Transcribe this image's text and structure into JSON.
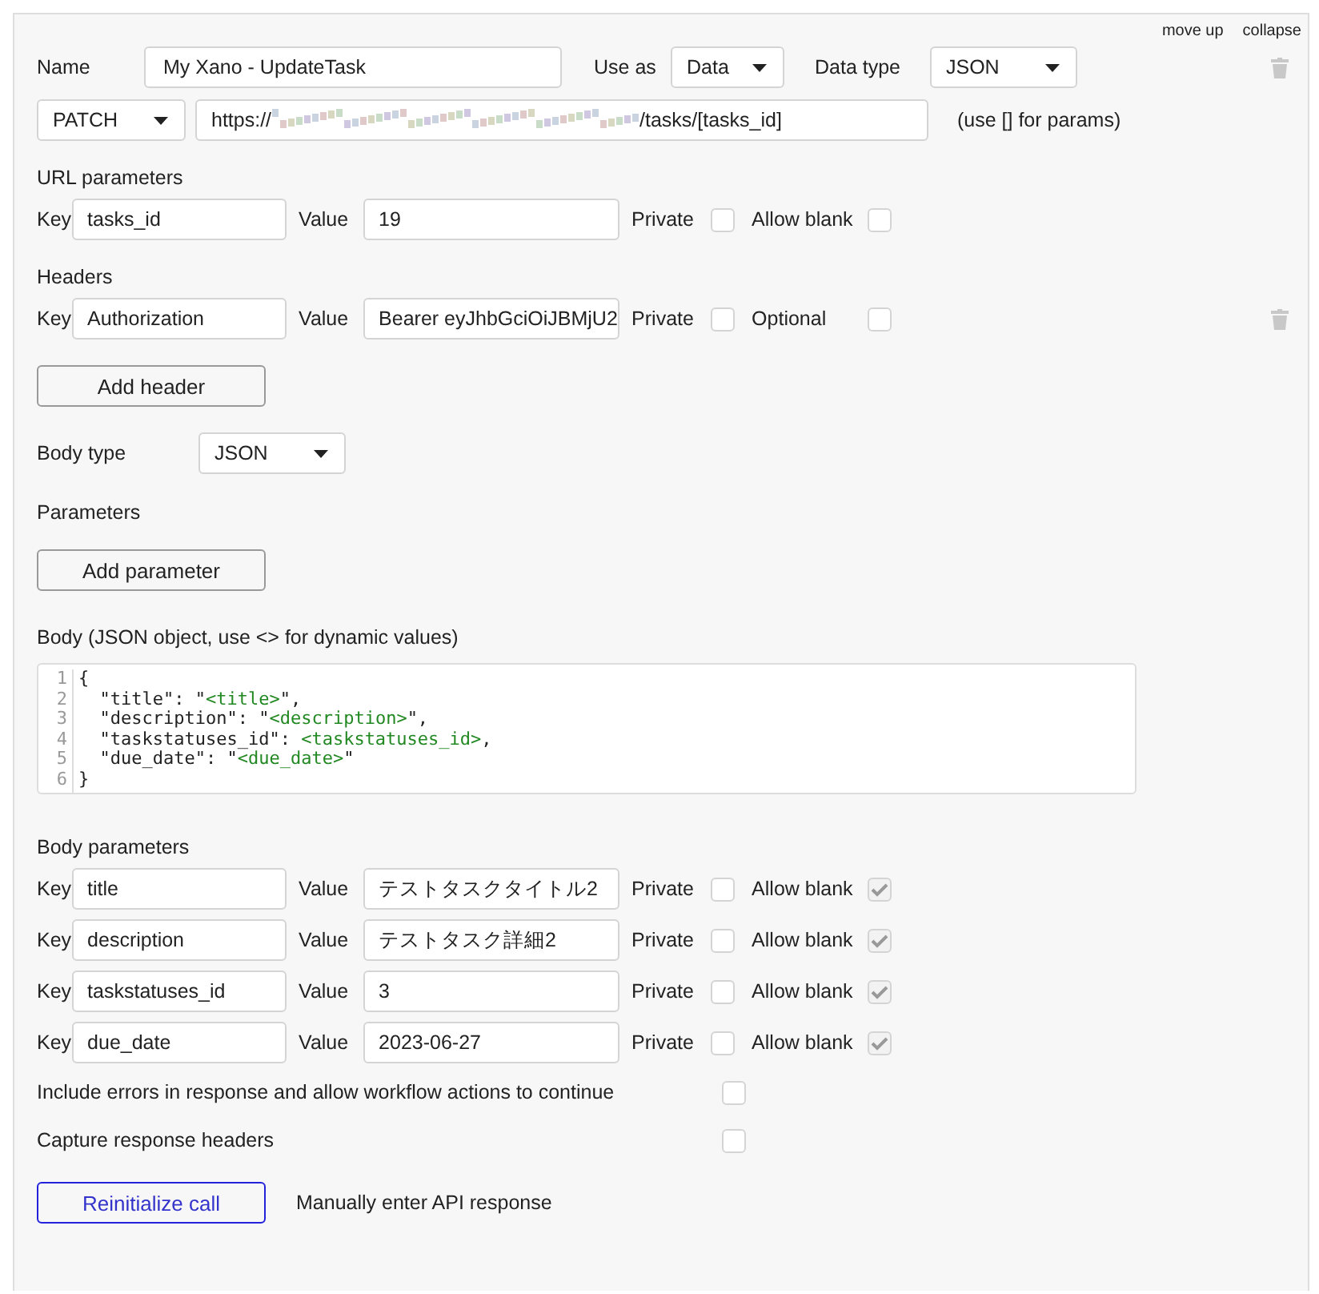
{
  "header_links": [
    {
      "label": "move up"
    },
    {
      "label": "collapse"
    }
  ],
  "name": {
    "label": "Name",
    "value": "My Xano - UpdateTask"
  },
  "use_as": {
    "label": "Use as",
    "value": "Data"
  },
  "data_type": {
    "label": "Data type",
    "value": "JSON"
  },
  "method": {
    "value": "PATCH"
  },
  "url": {
    "prefix": "https://",
    "suffix": "/tasks/[tasks_id]",
    "hint": "(use [] for params)"
  },
  "url_parameters": {
    "title": "URL parameters",
    "rows": [
      {
        "key_label": "Key",
        "key": "tasks_id",
        "value_label": "Value",
        "value": "19",
        "private_label": "Private",
        "private": false,
        "option_label": "Allow blank",
        "option": false
      }
    ]
  },
  "headers": {
    "title": "Headers",
    "rows": [
      {
        "key_label": "Key",
        "key": "Authorization",
        "value_label": "Value",
        "value": "Bearer eyJhbGciOiJBMjU2",
        "private_label": "Private",
        "private": false,
        "option_label": "Optional",
        "option": false
      }
    ],
    "button": "Add header"
  },
  "body_type": {
    "label": "Body type",
    "value": "JSON"
  },
  "parameters": {
    "title": "Parameters",
    "button": "Add parameter"
  },
  "body": {
    "label": "Body (JSON object, use <> for dynamic values)",
    "lines": [
      {
        "number": "1",
        "segments": [
          {
            "kind": "plain",
            "text": "{"
          }
        ]
      },
      {
        "number": "2",
        "segments": [
          {
            "kind": "plain",
            "text": "  \"title\": \""
          },
          {
            "kind": "var",
            "text": "<title>"
          },
          {
            "kind": "plain",
            "text": "\","
          }
        ]
      },
      {
        "number": "3",
        "segments": [
          {
            "kind": "plain",
            "text": "  \"description\": \""
          },
          {
            "kind": "var",
            "text": "<description>"
          },
          {
            "kind": "plain",
            "text": "\","
          }
        ]
      },
      {
        "number": "4",
        "segments": [
          {
            "kind": "plain",
            "text": "  \"taskstatuses_id\": "
          },
          {
            "kind": "var",
            "text": "<taskstatuses_id>"
          },
          {
            "kind": "plain",
            "text": ","
          }
        ]
      },
      {
        "number": "5",
        "segments": [
          {
            "kind": "plain",
            "text": "  \"due_date\": \""
          },
          {
            "kind": "var",
            "text": "<due_date>"
          },
          {
            "kind": "plain",
            "text": "\""
          }
        ]
      },
      {
        "number": "6",
        "segments": [
          {
            "kind": "plain",
            "text": "}"
          }
        ]
      }
    ]
  },
  "body_parameters": {
    "title": "Body parameters",
    "rows": [
      {
        "key_label": "Key",
        "key": "title",
        "value_label": "Value",
        "value": "テストタスクタイトル2",
        "private_label": "Private",
        "private": false,
        "option_label": "Allow blank",
        "option": true
      },
      {
        "key_label": "Key",
        "key": "description",
        "value_label": "Value",
        "value": "テストタスク詳細2",
        "private_label": "Private",
        "private": false,
        "option_label": "Allow blank",
        "option": true
      },
      {
        "key_label": "Key",
        "key": "taskstatuses_id",
        "value_label": "Value",
        "value": "3",
        "private_label": "Private",
        "private": false,
        "option_label": "Allow blank",
        "option": true
      },
      {
        "key_label": "Key",
        "key": "due_date",
        "value_label": "Value",
        "value": "2023-06-27",
        "private_label": "Private",
        "private": false,
        "option_label": "Allow blank",
        "option": true
      }
    ]
  },
  "options": [
    {
      "label": "Include errors in response and allow workflow actions to continue",
      "checked": false
    },
    {
      "label": "Capture response headers",
      "checked": false
    }
  ],
  "reinitialize_button": "Reinitialize call",
  "manual_link": "Manually enter API response"
}
